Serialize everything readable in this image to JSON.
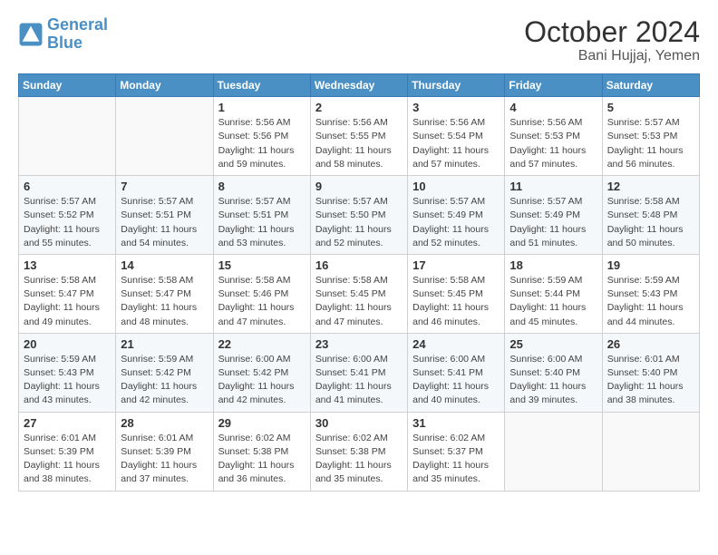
{
  "header": {
    "logo_line1": "General",
    "logo_line2": "Blue",
    "month": "October 2024",
    "location": "Bani Hujjaj, Yemen"
  },
  "days_of_week": [
    "Sunday",
    "Monday",
    "Tuesday",
    "Wednesday",
    "Thursday",
    "Friday",
    "Saturday"
  ],
  "weeks": [
    [
      {
        "day": "",
        "info": ""
      },
      {
        "day": "",
        "info": ""
      },
      {
        "day": "1",
        "info": "Sunrise: 5:56 AM\nSunset: 5:56 PM\nDaylight: 11 hours\nand 59 minutes."
      },
      {
        "day": "2",
        "info": "Sunrise: 5:56 AM\nSunset: 5:55 PM\nDaylight: 11 hours\nand 58 minutes."
      },
      {
        "day": "3",
        "info": "Sunrise: 5:56 AM\nSunset: 5:54 PM\nDaylight: 11 hours\nand 57 minutes."
      },
      {
        "day": "4",
        "info": "Sunrise: 5:56 AM\nSunset: 5:53 PM\nDaylight: 11 hours\nand 57 minutes."
      },
      {
        "day": "5",
        "info": "Sunrise: 5:57 AM\nSunset: 5:53 PM\nDaylight: 11 hours\nand 56 minutes."
      }
    ],
    [
      {
        "day": "6",
        "info": "Sunrise: 5:57 AM\nSunset: 5:52 PM\nDaylight: 11 hours\nand 55 minutes."
      },
      {
        "day": "7",
        "info": "Sunrise: 5:57 AM\nSunset: 5:51 PM\nDaylight: 11 hours\nand 54 minutes."
      },
      {
        "day": "8",
        "info": "Sunrise: 5:57 AM\nSunset: 5:51 PM\nDaylight: 11 hours\nand 53 minutes."
      },
      {
        "day": "9",
        "info": "Sunrise: 5:57 AM\nSunset: 5:50 PM\nDaylight: 11 hours\nand 52 minutes."
      },
      {
        "day": "10",
        "info": "Sunrise: 5:57 AM\nSunset: 5:49 PM\nDaylight: 11 hours\nand 52 minutes."
      },
      {
        "day": "11",
        "info": "Sunrise: 5:57 AM\nSunset: 5:49 PM\nDaylight: 11 hours\nand 51 minutes."
      },
      {
        "day": "12",
        "info": "Sunrise: 5:58 AM\nSunset: 5:48 PM\nDaylight: 11 hours\nand 50 minutes."
      }
    ],
    [
      {
        "day": "13",
        "info": "Sunrise: 5:58 AM\nSunset: 5:47 PM\nDaylight: 11 hours\nand 49 minutes."
      },
      {
        "day": "14",
        "info": "Sunrise: 5:58 AM\nSunset: 5:47 PM\nDaylight: 11 hours\nand 48 minutes."
      },
      {
        "day": "15",
        "info": "Sunrise: 5:58 AM\nSunset: 5:46 PM\nDaylight: 11 hours\nand 47 minutes."
      },
      {
        "day": "16",
        "info": "Sunrise: 5:58 AM\nSunset: 5:45 PM\nDaylight: 11 hours\nand 47 minutes."
      },
      {
        "day": "17",
        "info": "Sunrise: 5:58 AM\nSunset: 5:45 PM\nDaylight: 11 hours\nand 46 minutes."
      },
      {
        "day": "18",
        "info": "Sunrise: 5:59 AM\nSunset: 5:44 PM\nDaylight: 11 hours\nand 45 minutes."
      },
      {
        "day": "19",
        "info": "Sunrise: 5:59 AM\nSunset: 5:43 PM\nDaylight: 11 hours\nand 44 minutes."
      }
    ],
    [
      {
        "day": "20",
        "info": "Sunrise: 5:59 AM\nSunset: 5:43 PM\nDaylight: 11 hours\nand 43 minutes."
      },
      {
        "day": "21",
        "info": "Sunrise: 5:59 AM\nSunset: 5:42 PM\nDaylight: 11 hours\nand 42 minutes."
      },
      {
        "day": "22",
        "info": "Sunrise: 6:00 AM\nSunset: 5:42 PM\nDaylight: 11 hours\nand 42 minutes."
      },
      {
        "day": "23",
        "info": "Sunrise: 6:00 AM\nSunset: 5:41 PM\nDaylight: 11 hours\nand 41 minutes."
      },
      {
        "day": "24",
        "info": "Sunrise: 6:00 AM\nSunset: 5:41 PM\nDaylight: 11 hours\nand 40 minutes."
      },
      {
        "day": "25",
        "info": "Sunrise: 6:00 AM\nSunset: 5:40 PM\nDaylight: 11 hours\nand 39 minutes."
      },
      {
        "day": "26",
        "info": "Sunrise: 6:01 AM\nSunset: 5:40 PM\nDaylight: 11 hours\nand 38 minutes."
      }
    ],
    [
      {
        "day": "27",
        "info": "Sunrise: 6:01 AM\nSunset: 5:39 PM\nDaylight: 11 hours\nand 38 minutes."
      },
      {
        "day": "28",
        "info": "Sunrise: 6:01 AM\nSunset: 5:39 PM\nDaylight: 11 hours\nand 37 minutes."
      },
      {
        "day": "29",
        "info": "Sunrise: 6:02 AM\nSunset: 5:38 PM\nDaylight: 11 hours\nand 36 minutes."
      },
      {
        "day": "30",
        "info": "Sunrise: 6:02 AM\nSunset: 5:38 PM\nDaylight: 11 hours\nand 35 minutes."
      },
      {
        "day": "31",
        "info": "Sunrise: 6:02 AM\nSunset: 5:37 PM\nDaylight: 11 hours\nand 35 minutes."
      },
      {
        "day": "",
        "info": ""
      },
      {
        "day": "",
        "info": ""
      }
    ]
  ]
}
